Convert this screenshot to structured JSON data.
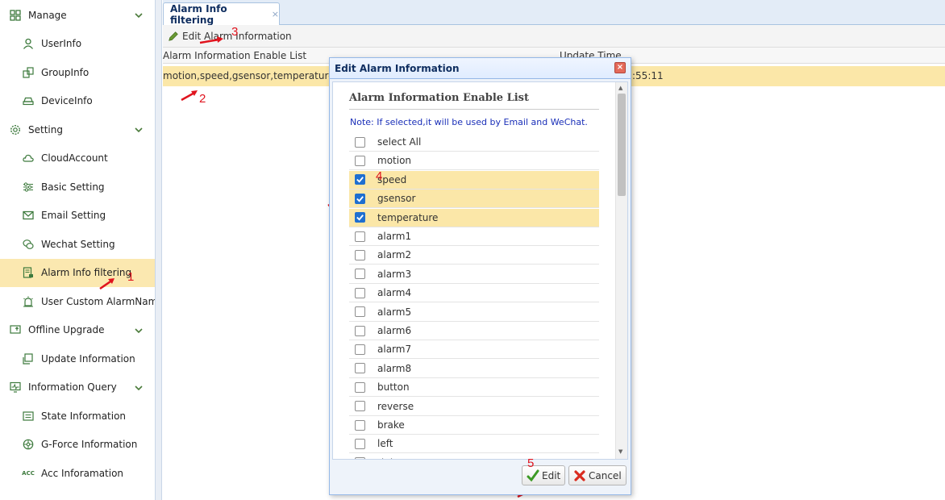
{
  "sidebar": {
    "items": [
      {
        "label": "Manage",
        "icon": "grid-icon",
        "type": "group"
      },
      {
        "label": "UserInfo",
        "icon": "user-icon",
        "type": "child"
      },
      {
        "label": "GroupInfo",
        "icon": "group-icon",
        "type": "child"
      },
      {
        "label": "DeviceInfo",
        "icon": "car-icon",
        "type": "child"
      },
      {
        "label": "Setting",
        "icon": "gear-icon",
        "type": "group"
      },
      {
        "label": "CloudAccount",
        "icon": "cloud-icon",
        "type": "child"
      },
      {
        "label": "Basic Setting",
        "icon": "sliders-icon",
        "type": "child"
      },
      {
        "label": "Email Setting",
        "icon": "mail-icon",
        "type": "child"
      },
      {
        "label": "Wechat Setting",
        "icon": "wechat-icon",
        "type": "child"
      },
      {
        "label": "Alarm Info filtering",
        "icon": "filter-doc-icon",
        "type": "child",
        "active": true
      },
      {
        "label": "User Custom AlarmName",
        "icon": "alarm-icon",
        "type": "child"
      },
      {
        "label": "Offline Upgrade",
        "icon": "upgrade-icon",
        "type": "group"
      },
      {
        "label": "Update Information",
        "icon": "update-icon",
        "type": "child"
      },
      {
        "label": "Information Query",
        "icon": "monitor-icon",
        "type": "group"
      },
      {
        "label": "State Information",
        "icon": "state-icon",
        "type": "child"
      },
      {
        "label": "G-Force Information",
        "icon": "gforce-icon",
        "type": "child"
      },
      {
        "label": "Acc Inforamation",
        "icon": "acc-icon",
        "type": "child"
      }
    ],
    "acc_icon_text": "ACC"
  },
  "tab": {
    "label": "Alarm Info filtering",
    "close": "×"
  },
  "toolbar": {
    "edit_label": "Edit Alarm Information"
  },
  "grid": {
    "headers": {
      "list": "Alarm Information Enable List",
      "time": "Update Time"
    },
    "row": {
      "list": "motion,speed,gsensor,temperature,a",
      "time": ":55:11"
    }
  },
  "annotations": {
    "n1": "1",
    "n2": "2",
    "n3": "3",
    "n4": "4",
    "n5": "5"
  },
  "dialog": {
    "title": "Edit Alarm Information",
    "close": "×",
    "section_title": "Alarm Information Enable List",
    "note": "Note: If selected,it will be used by Email and WeChat.",
    "options": [
      {
        "label": "select All",
        "checked": false
      },
      {
        "label": "motion",
        "checked": false
      },
      {
        "label": "speed",
        "checked": true
      },
      {
        "label": "gsensor",
        "checked": true
      },
      {
        "label": "temperature",
        "checked": true
      },
      {
        "label": "alarm1",
        "checked": false
      },
      {
        "label": "alarm2",
        "checked": false
      },
      {
        "label": "alarm3",
        "checked": false
      },
      {
        "label": "alarm4",
        "checked": false
      },
      {
        "label": "alarm5",
        "checked": false
      },
      {
        "label": "alarm6",
        "checked": false
      },
      {
        "label": "alarm7",
        "checked": false
      },
      {
        "label": "alarm8",
        "checked": false
      },
      {
        "label": "button",
        "checked": false
      },
      {
        "label": "reverse",
        "checked": false
      },
      {
        "label": "brake",
        "checked": false
      },
      {
        "label": "left",
        "checked": false
      },
      {
        "label": "right",
        "checked": false
      }
    ],
    "edit_label": "Edit",
    "cancel_label": "Cancel"
  },
  "colors": {
    "accent_green": "#3d7a3d",
    "highlight": "#fbe7a8",
    "note_blue": "#1a2fb8",
    "annotation_red": "#e0141e",
    "checkbox_blue": "#1f6fd0"
  }
}
